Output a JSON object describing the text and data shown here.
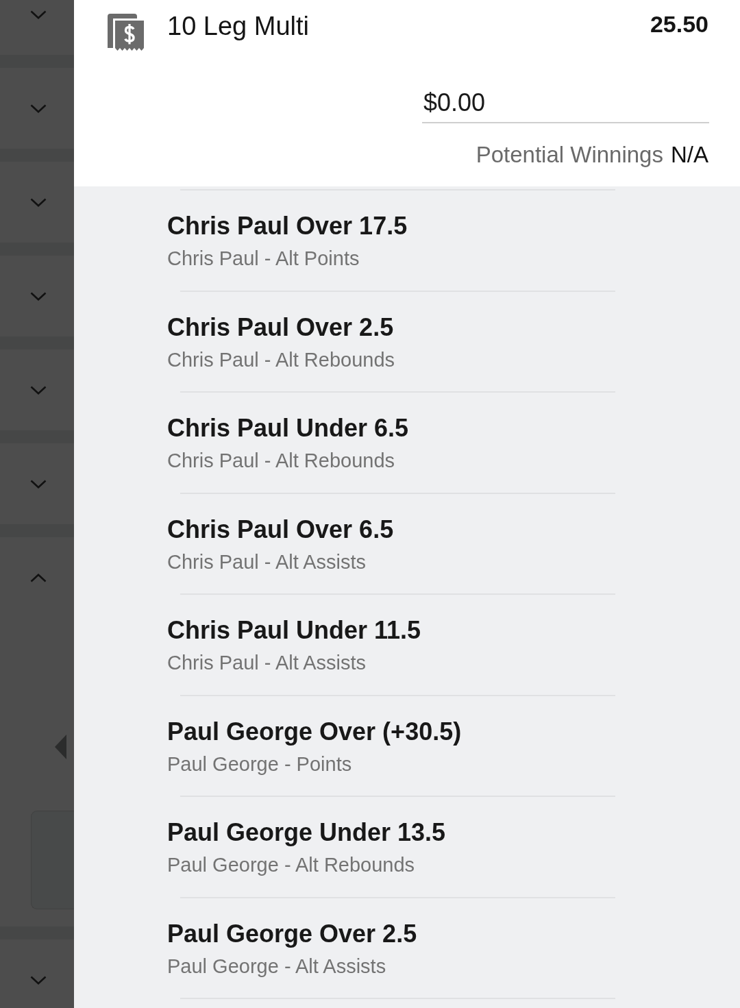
{
  "sidebar": {
    "items": [
      {
        "expanded": false
      },
      {
        "expanded": false
      },
      {
        "expanded": false
      },
      {
        "expanded": false
      },
      {
        "expanded": false
      },
      {
        "expanded": false
      },
      {
        "expanded": true
      },
      {
        "expanded": false
      }
    ]
  },
  "bet_slip": {
    "title": "10 Leg Multi",
    "odds": "25.50",
    "stake": {
      "value": "$0.00"
    },
    "potential_winnings": {
      "label": "Potential Winnings",
      "value": "N/A"
    }
  },
  "legs": [
    {
      "selection": "Chris Paul Over 17.5",
      "market": "Chris Paul - Alt Points"
    },
    {
      "selection": "Chris Paul Over 2.5",
      "market": "Chris Paul - Alt Rebounds"
    },
    {
      "selection": "Chris Paul Under 6.5",
      "market": "Chris Paul - Alt Rebounds"
    },
    {
      "selection": "Chris Paul Over 6.5",
      "market": "Chris Paul - Alt Assists"
    },
    {
      "selection": "Chris Paul Under 11.5",
      "market": "Chris Paul - Alt Assists"
    },
    {
      "selection": "Paul George Over (+30.5)",
      "market": "Paul George - Points"
    },
    {
      "selection": "Paul George Under 13.5",
      "market": "Paul George - Alt Rebounds"
    },
    {
      "selection": "Paul George Over 2.5",
      "market": "Paul George - Alt Assists"
    }
  ]
}
